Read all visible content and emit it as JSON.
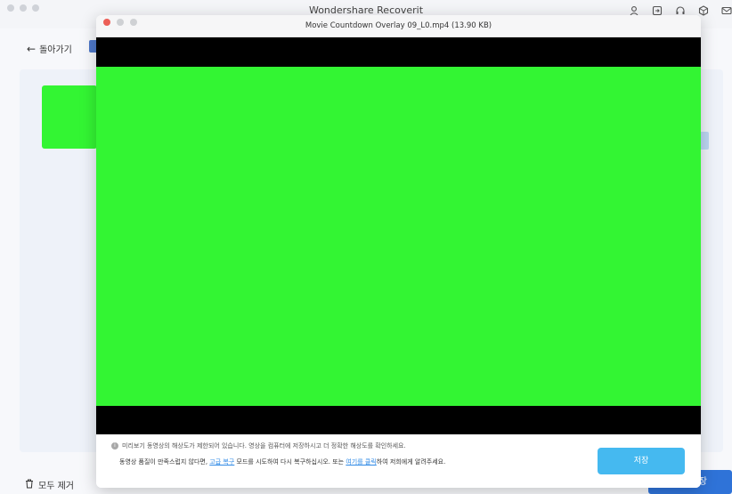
{
  "app": {
    "title": "Wondershare Recoverit",
    "back_label": "돌아가기",
    "remove_all_label": "모두 제거",
    "save_label": "장"
  },
  "header_icons": [
    "user-icon",
    "import-icon",
    "headset-icon",
    "cube-icon",
    "mail-icon"
  ],
  "preview": {
    "title": "Movie Countdown Overlay 09_L0.mp4 (13.90 KB)",
    "info_text": "미리보기 동영상의 해상도가 제한되어 있습니다. 영상을 컴퓨터에 저장하시고 더 정확한 해상도를 확인하세요.",
    "quality_prefix": "동영상 품질이 만족스럽지 않다면, ",
    "advanced_link": "고급 복구",
    "quality_middle": " 모드를 시도하여 다시 복구하십시오. 또는 ",
    "click_link": "여기를 클릭",
    "quality_suffix": "하여 저희에게 알려주세요.",
    "save_label": "저장"
  },
  "colors": {
    "video_green": "#33f533",
    "save_button": "#45b9f0",
    "link": "#2f8ae6",
    "close_dot": "#ec5f57"
  }
}
